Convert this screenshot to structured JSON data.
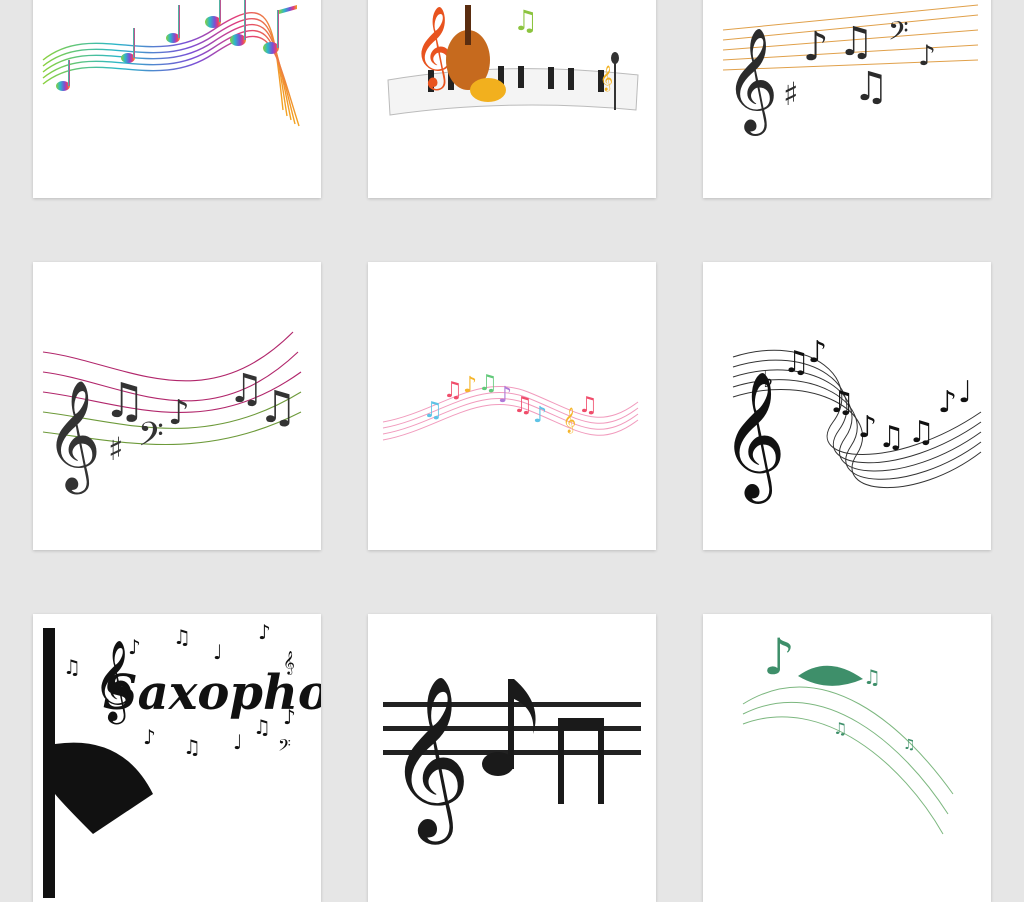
{
  "gallery": {
    "tiles": [
      {
        "label": "",
        "theme": "rainbow-notes-wave"
      },
      {
        "label": "",
        "theme": "violin-piano-notes"
      },
      {
        "label": "",
        "theme": "treble-clef-staff-black"
      },
      {
        "label": "",
        "theme": "staff-with-clefs-magenta-green"
      },
      {
        "label": "",
        "theme": "pastel-notes-ribbon"
      },
      {
        "label": "",
        "theme": "curving-staff-black-notes"
      },
      {
        "label": "Saxophone",
        "theme": "saxophone-notes-poster"
      },
      {
        "label": "",
        "theme": "glossy-clef-on-staff"
      },
      {
        "label": "",
        "theme": "green-leaf-notes"
      }
    ]
  },
  "colors": {
    "background": "#e6e6e6",
    "tile": "#ffffff",
    "ink": "#2b2b2b"
  },
  "icons": [
    "treble-clef-icon",
    "bass-clef-icon",
    "sharp-icon",
    "eighth-note-icon",
    "beamed-notes-icon",
    "violin-icon",
    "piano-keys-icon",
    "microphone-icon",
    "saxophone-icon",
    "leaf-icon"
  ]
}
